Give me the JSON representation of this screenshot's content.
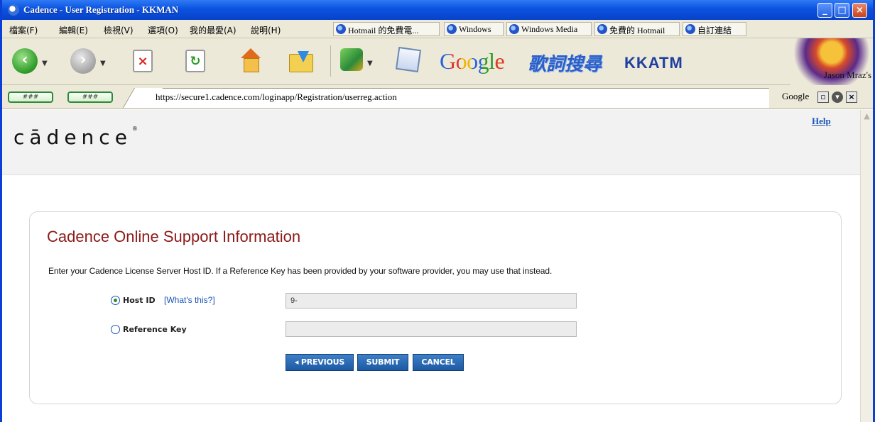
{
  "window": {
    "title": "Cadence - User Registration - KKMAN"
  },
  "menu": [
    "檔案(F)",
    "編輯(E)",
    "檢視(V)",
    "選項(O)",
    "我的最愛(A)",
    "說明(H)"
  ],
  "bookmarks": [
    "Hotmail 的免費電...",
    "Windows",
    "Windows Media",
    "免費的 Hotmail",
    "自訂連結"
  ],
  "toolbar": {
    "google": "Google",
    "lyrics": "歌詞搜尋",
    "kkatm": "KKATM",
    "banner_text": "Jason Mraz's"
  },
  "address": {
    "pill1": "###",
    "pill2": "###",
    "url": "https://secure1.cadence.com/loginapp/Registration/userreg.action",
    "search_label": "Google"
  },
  "page": {
    "logo": "cādence",
    "logo_mark": "®",
    "help": "Help",
    "heading": "Cadence Online Support Information",
    "description": "Enter your Cadence License Server Host ID. If a Reference Key has been provided by your software provider, you may use that instead.",
    "host_id": {
      "label": "Host ID",
      "help_link": "[What's this?]",
      "value": "9-",
      "selected": true
    },
    "reference_key": {
      "label": "Reference Key",
      "value": "",
      "selected": false
    },
    "buttons": {
      "previous": "◂ PREVIOUS",
      "submit": "SUBMIT",
      "cancel": "CANCEL"
    }
  }
}
